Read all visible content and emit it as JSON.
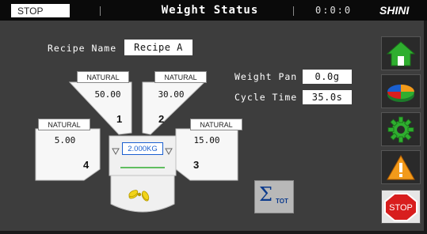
{
  "topbar": {
    "status": "STOP",
    "title": "Weight Status",
    "clock": "0:0:0",
    "brand": "SHINI"
  },
  "recipe": {
    "label": "Recipe Name",
    "value": "Recipe A"
  },
  "weight_pan": {
    "label": "Weight Pan",
    "value": "0.0g"
  },
  "cycle_time": {
    "label": "Cycle Time",
    "value": "35.0s"
  },
  "hoppers": [
    {
      "number": "1",
      "material": "NATURAL",
      "value": "50.00"
    },
    {
      "number": "2",
      "material": "NATURAL",
      "value": "30.00"
    },
    {
      "number": "3",
      "material": "NATURAL",
      "value": "15.00"
    },
    {
      "number": "4",
      "material": "NATURAL",
      "value": "5.00"
    }
  ],
  "scale": {
    "reading": "2.000KG"
  },
  "total_button": {
    "symbol": "Σ",
    "sub": "TOT"
  },
  "side_buttons": [
    {
      "icon": "home-icon"
    },
    {
      "icon": "pie-chart-icon"
    },
    {
      "icon": "gear-icon"
    },
    {
      "icon": "warning-icon"
    },
    {
      "icon": "stop-icon",
      "label": "STOP"
    }
  ],
  "colors": {
    "accent_green": "#2fae2f",
    "stop_red": "#d81e1e",
    "warning_orange": "#f29a1a",
    "scale_blue": "#1a5fd0"
  }
}
